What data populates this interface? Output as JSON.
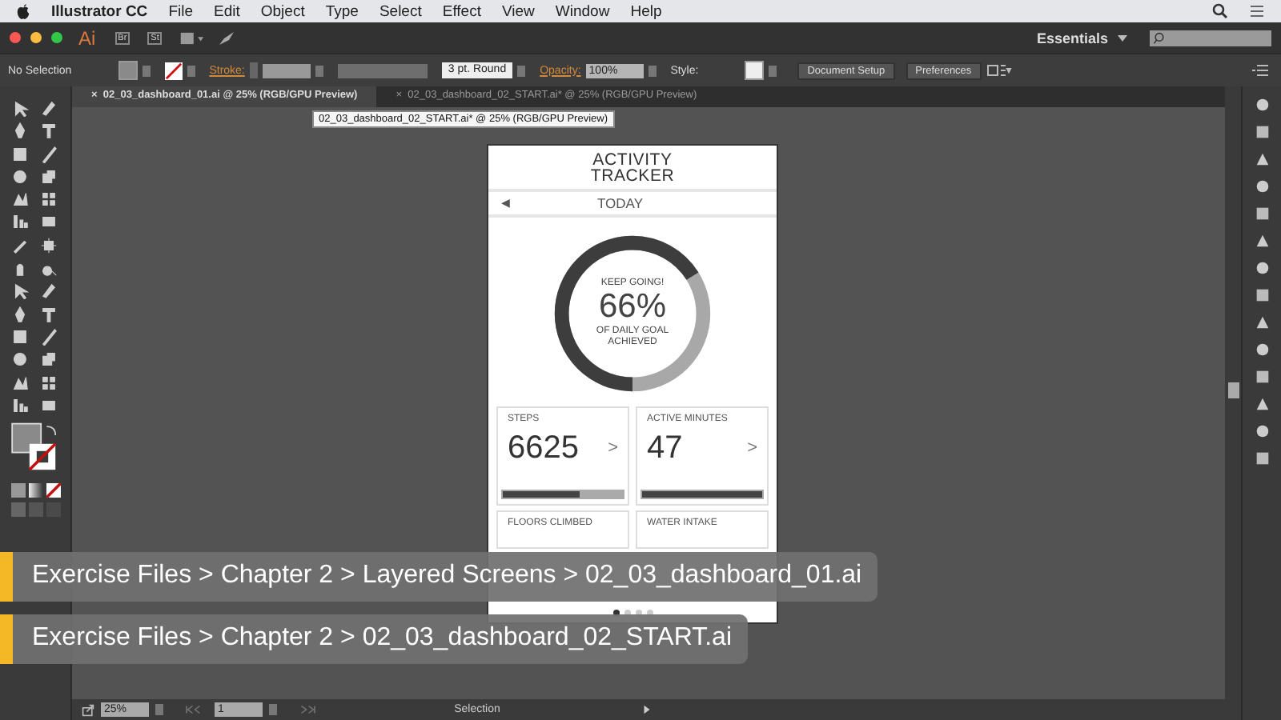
{
  "menu_bar": {
    "app": "Illustrator CC",
    "items": [
      "File",
      "Edit",
      "Object",
      "Type",
      "Select",
      "Effect",
      "View",
      "Window",
      "Help"
    ]
  },
  "app_bar": {
    "logo": "Ai",
    "bridge": "Br",
    "stock": "St",
    "workspace": "Essentials"
  },
  "control_bar": {
    "selection": "No Selection",
    "stroke_label": "Stroke:",
    "stroke_profile": "3 pt. Round",
    "opacity_label": "Opacity:",
    "opacity": "100%",
    "style_label": "Style:",
    "buttons": [
      "Document Setup",
      "Preferences"
    ]
  },
  "tabs": [
    {
      "label": "02_03_dashboard_01.ai @ 25% (RGB/GPU Preview)",
      "close": "×",
      "selected": true
    },
    {
      "label": "02_03_dashboard_02_START.ai* @ 25% (RGB/GPU Preview)",
      "close": "×",
      "selected": false
    }
  ],
  "tooltip": "02_03_dashboard_02_START.ai* @ 25% (RGB/GPU Preview)",
  "artboard": {
    "title": "ACTIVITY TRACKER",
    "nav_arrow": "◀",
    "date": "TODAY",
    "goal": {
      "caption": "KEEP GOING!",
      "percent": "66%",
      "subcaption": "OF DAILY GOAL ACHIEVED",
      "level": 0.66
    },
    "cards": [
      {
        "label": "STEPS",
        "value": "6625",
        "chevron": ">",
        "level": 0.64
      },
      {
        "label": "ACTIVE MINUTES",
        "value": "47",
        "chevron": ">",
        "level": 1
      },
      {
        "label": "FLOORS CLIMBED"
      },
      {
        "label": "WATER INTAKE"
      }
    ],
    "pages": [
      {
        "selected": true
      },
      {
        "selected": false
      },
      {
        "selected": false
      },
      {
        "selected": false
      }
    ]
  },
  "captions": [
    "Exercise Files > Chapter 2 > Layered Screens > 02_03_dashboard_01.ai",
    "Exercise Files > Chapter 2 > 02_03_dashboard_02_START.ai"
  ],
  "status_bar": {
    "zoom": "25%",
    "artboard": "1",
    "tool": "Selection"
  }
}
